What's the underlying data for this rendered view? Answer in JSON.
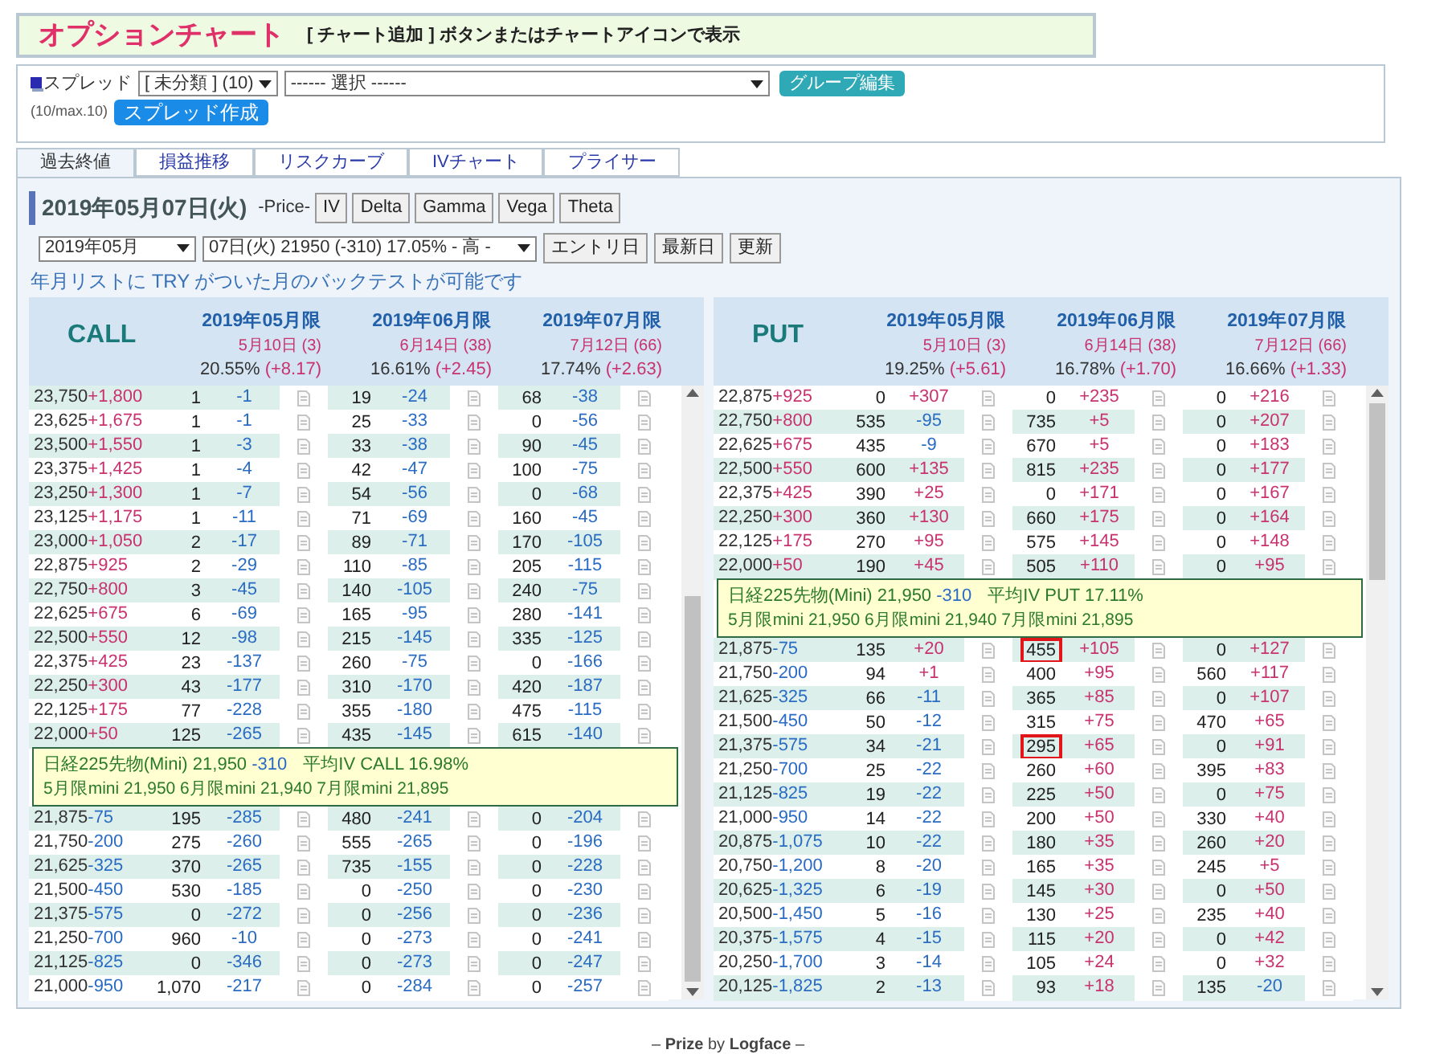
{
  "header": {
    "title": "オプションチャート",
    "hint": "[ チャート追加 ] ボタンまたはチャートアイコンで表示"
  },
  "spread": {
    "label": "スプレッド",
    "group_select": "[ 未分類 ] (10)",
    "spread_select": "------ 選択 ------",
    "edit_button": "グループ編集",
    "count": "(10/max.10)",
    "create_button": "スプレッド作成"
  },
  "tabs": [
    {
      "label": "過去終値",
      "selected": true
    },
    {
      "label": "損益推移",
      "selected": false
    },
    {
      "label": "リスクカーブ",
      "selected": false
    },
    {
      "label": "IVチャート",
      "selected": false
    },
    {
      "label": "プライサー",
      "selected": false
    }
  ],
  "panel": {
    "date": "2019年05月07日(火)",
    "price_label": "-Price-",
    "metric_buttons": [
      "IV",
      "Delta",
      "Gamma",
      "Vega",
      "Theta"
    ],
    "month_select": "2019年05月",
    "day_select": "07日(火) 21950 (-310) 17.05% - 高 -",
    "action_buttons": [
      "エントリ日",
      "最新日",
      "更新"
    ],
    "note": "年月リストに TRY がついた月のバックテストが可能です"
  },
  "tables": [
    {
      "title": "CALL",
      "months": [
        {
          "name": "2019年05月限",
          "expiry": "5月10日 (3)",
          "iv": "20.55%",
          "iv_change": "(+8.17)"
        },
        {
          "name": "2019年06月限",
          "expiry": "6月14日 (38)",
          "iv": "16.61%",
          "iv_change": "(+2.45)"
        },
        {
          "name": "2019年07月限",
          "expiry": "7月12日 (66)",
          "iv": "17.74%",
          "iv_change": "(+2.63)"
        }
      ],
      "rows_above": [
        {
          "strike": "23,750",
          "diff": "+1,800",
          "diff_up": true,
          "shaded": true,
          "cells": [
            {
              "price": "1",
              "change": "-1",
              "up": false,
              "marked": false
            },
            {
              "price": "19",
              "change": "-24",
              "up": false,
              "marked": false
            },
            {
              "price": "68",
              "change": "-38",
              "up": false,
              "marked": false
            }
          ]
        },
        {
          "strike": "23,625",
          "diff": "+1,675",
          "diff_up": true,
          "shaded": false,
          "cells": [
            {
              "price": "1",
              "change": "-1",
              "up": false,
              "marked": false
            },
            {
              "price": "25",
              "change": "-33",
              "up": false,
              "marked": false
            },
            {
              "price": "0",
              "change": "-56",
              "up": false,
              "marked": false
            }
          ]
        },
        {
          "strike": "23,500",
          "diff": "+1,550",
          "diff_up": true,
          "shaded": true,
          "cells": [
            {
              "price": "1",
              "change": "-3",
              "up": false,
              "marked": false
            },
            {
              "price": "33",
              "change": "-38",
              "up": false,
              "marked": false
            },
            {
              "price": "90",
              "change": "-45",
              "up": false,
              "marked": false
            }
          ]
        },
        {
          "strike": "23,375",
          "diff": "+1,425",
          "diff_up": true,
          "shaded": false,
          "cells": [
            {
              "price": "1",
              "change": "-4",
              "up": false,
              "marked": false
            },
            {
              "price": "42",
              "change": "-47",
              "up": false,
              "marked": false
            },
            {
              "price": "100",
              "change": "-75",
              "up": false,
              "marked": false
            }
          ]
        },
        {
          "strike": "23,250",
          "diff": "+1,300",
          "diff_up": true,
          "shaded": true,
          "cells": [
            {
              "price": "1",
              "change": "-7",
              "up": false,
              "marked": false
            },
            {
              "price": "54",
              "change": "-56",
              "up": false,
              "marked": false
            },
            {
              "price": "0",
              "change": "-68",
              "up": false,
              "marked": false
            }
          ]
        },
        {
          "strike": "23,125",
          "diff": "+1,175",
          "diff_up": true,
          "shaded": false,
          "cells": [
            {
              "price": "1",
              "change": "-11",
              "up": false,
              "marked": false
            },
            {
              "price": "71",
              "change": "-69",
              "up": false,
              "marked": false
            },
            {
              "price": "160",
              "change": "-45",
              "up": false,
              "marked": false
            }
          ]
        },
        {
          "strike": "23,000",
          "diff": "+1,050",
          "diff_up": true,
          "shaded": true,
          "cells": [
            {
              "price": "2",
              "change": "-17",
              "up": false,
              "marked": false
            },
            {
              "price": "89",
              "change": "-71",
              "up": false,
              "marked": false
            },
            {
              "price": "170",
              "change": "-105",
              "up": false,
              "marked": false
            }
          ]
        },
        {
          "strike": "22,875",
          "diff": "+925",
          "diff_up": true,
          "shaded": false,
          "cells": [
            {
              "price": "2",
              "change": "-29",
              "up": false,
              "marked": false
            },
            {
              "price": "110",
              "change": "-85",
              "up": false,
              "marked": false
            },
            {
              "price": "205",
              "change": "-115",
              "up": false,
              "marked": false
            }
          ]
        },
        {
          "strike": "22,750",
          "diff": "+800",
          "diff_up": true,
          "shaded": true,
          "cells": [
            {
              "price": "3",
              "change": "-45",
              "up": false,
              "marked": false
            },
            {
              "price": "140",
              "change": "-105",
              "up": false,
              "marked": false
            },
            {
              "price": "240",
              "change": "-75",
              "up": false,
              "marked": false
            }
          ]
        },
        {
          "strike": "22,625",
          "diff": "+675",
          "diff_up": true,
          "shaded": false,
          "cells": [
            {
              "price": "6",
              "change": "-69",
              "up": false,
              "marked": false
            },
            {
              "price": "165",
              "change": "-95",
              "up": false,
              "marked": false
            },
            {
              "price": "280",
              "change": "-141",
              "up": false,
              "marked": false
            }
          ]
        },
        {
          "strike": "22,500",
          "diff": "+550",
          "diff_up": true,
          "shaded": true,
          "cells": [
            {
              "price": "12",
              "change": "-98",
              "up": false,
              "marked": false
            },
            {
              "price": "215",
              "change": "-145",
              "up": false,
              "marked": false
            },
            {
              "price": "335",
              "change": "-125",
              "up": false,
              "marked": false
            }
          ]
        },
        {
          "strike": "22,375",
          "diff": "+425",
          "diff_up": true,
          "shaded": false,
          "cells": [
            {
              "price": "23",
              "change": "-137",
              "up": false,
              "marked": false
            },
            {
              "price": "260",
              "change": "-75",
              "up": false,
              "marked": false
            },
            {
              "price": "0",
              "change": "-166",
              "up": false,
              "marked": false
            }
          ]
        },
        {
          "strike": "22,250",
          "diff": "+300",
          "diff_up": true,
          "shaded": true,
          "cells": [
            {
              "price": "43",
              "change": "-177",
              "up": false,
              "marked": false
            },
            {
              "price": "310",
              "change": "-170",
              "up": false,
              "marked": false
            },
            {
              "price": "420",
              "change": "-187",
              "up": false,
              "marked": false
            }
          ]
        },
        {
          "strike": "22,125",
          "diff": "+175",
          "diff_up": true,
          "shaded": false,
          "cells": [
            {
              "price": "77",
              "change": "-228",
              "up": false,
              "marked": false
            },
            {
              "price": "355",
              "change": "-180",
              "up": false,
              "marked": false
            },
            {
              "price": "475",
              "change": "-115",
              "up": false,
              "marked": false
            }
          ]
        },
        {
          "strike": "22,000",
          "diff": "+50",
          "diff_up": true,
          "shaded": true,
          "cells": [
            {
              "price": "125",
              "change": "-265",
              "up": false,
              "marked": false
            },
            {
              "price": "435",
              "change": "-145",
              "up": false,
              "marked": false
            },
            {
              "price": "615",
              "change": "-140",
              "up": false,
              "marked": false
            }
          ]
        }
      ],
      "summary": {
        "futures": "日経225先物(Mini) 21,950",
        "futures_change": "-310",
        "average_iv": "平均IV CALL 16.98%",
        "minis": "5月限mini 21,950 6月限mini 21,940 7月限mini 21,895"
      },
      "rows_below": [
        {
          "strike": "21,875",
          "diff": "-75",
          "diff_up": false,
          "shaded": true,
          "cells": [
            {
              "price": "195",
              "change": "-285",
              "up": false,
              "marked": false
            },
            {
              "price": "480",
              "change": "-241",
              "up": false,
              "marked": false
            },
            {
              "price": "0",
              "change": "-204",
              "up": false,
              "marked": false
            }
          ]
        },
        {
          "strike": "21,750",
          "diff": "-200",
          "diff_up": false,
          "shaded": false,
          "cells": [
            {
              "price": "275",
              "change": "-260",
              "up": false,
              "marked": false
            },
            {
              "price": "555",
              "change": "-265",
              "up": false,
              "marked": false
            },
            {
              "price": "0",
              "change": "-196",
              "up": false,
              "marked": false
            }
          ]
        },
        {
          "strike": "21,625",
          "diff": "-325",
          "diff_up": false,
          "shaded": true,
          "cells": [
            {
              "price": "370",
              "change": "-265",
              "up": false,
              "marked": false
            },
            {
              "price": "735",
              "change": "-155",
              "up": false,
              "marked": false
            },
            {
              "price": "0",
              "change": "-228",
              "up": false,
              "marked": false
            }
          ]
        },
        {
          "strike": "21,500",
          "diff": "-450",
          "diff_up": false,
          "shaded": false,
          "cells": [
            {
              "price": "530",
              "change": "-185",
              "up": false,
              "marked": false
            },
            {
              "price": "0",
              "change": "-250",
              "up": false,
              "marked": false
            },
            {
              "price": "0",
              "change": "-230",
              "up": false,
              "marked": false
            }
          ]
        },
        {
          "strike": "21,375",
          "diff": "-575",
          "diff_up": false,
          "shaded": true,
          "cells": [
            {
              "price": "0",
              "change": "-272",
              "up": false,
              "marked": false
            },
            {
              "price": "0",
              "change": "-256",
              "up": false,
              "marked": false
            },
            {
              "price": "0",
              "change": "-236",
              "up": false,
              "marked": false
            }
          ]
        },
        {
          "strike": "21,250",
          "diff": "-700",
          "diff_up": false,
          "shaded": false,
          "cells": [
            {
              "price": "960",
              "change": "-10",
              "up": false,
              "marked": false
            },
            {
              "price": "0",
              "change": "-273",
              "up": false,
              "marked": false
            },
            {
              "price": "0",
              "change": "-241",
              "up": false,
              "marked": false
            }
          ]
        },
        {
          "strike": "21,125",
          "diff": "-825",
          "diff_up": false,
          "shaded": true,
          "cells": [
            {
              "price": "0",
              "change": "-346",
              "up": false,
              "marked": false
            },
            {
              "price": "0",
              "change": "-273",
              "up": false,
              "marked": false
            },
            {
              "price": "0",
              "change": "-247",
              "up": false,
              "marked": false
            }
          ]
        },
        {
          "strike": "21,000",
          "diff": "-950",
          "diff_up": false,
          "shaded": false,
          "cells": [
            {
              "price": "1,070",
              "change": "-217",
              "up": false,
              "marked": false
            },
            {
              "price": "0",
              "change": "-284",
              "up": false,
              "marked": false
            },
            {
              "price": "0",
              "change": "-257",
              "up": false,
              "marked": false
            }
          ]
        }
      ]
    },
    {
      "title": "PUT",
      "months": [
        {
          "name": "2019年05月限",
          "expiry": "5月10日 (3)",
          "iv": "19.25%",
          "iv_change": "(+5.61)"
        },
        {
          "name": "2019年06月限",
          "expiry": "6月14日 (38)",
          "iv": "16.78%",
          "iv_change": "(+1.70)"
        },
        {
          "name": "2019年07月限",
          "expiry": "7月12日 (66)",
          "iv": "16.66%",
          "iv_change": "(+1.33)"
        }
      ],
      "rows_above": [
        {
          "strike": "22,875",
          "diff": "+925",
          "diff_up": true,
          "shaded": false,
          "cells": [
            {
              "price": "0",
              "change": "+307",
              "up": true,
              "marked": false
            },
            {
              "price": "0",
              "change": "+235",
              "up": true,
              "marked": false
            },
            {
              "price": "0",
              "change": "+216",
              "up": true,
              "marked": false
            }
          ]
        },
        {
          "strike": "22,750",
          "diff": "+800",
          "diff_up": true,
          "shaded": true,
          "cells": [
            {
              "price": "535",
              "change": "-95",
              "up": false,
              "marked": false
            },
            {
              "price": "735",
              "change": "+5",
              "up": true,
              "marked": false
            },
            {
              "price": "0",
              "change": "+207",
              "up": true,
              "marked": false
            }
          ]
        },
        {
          "strike": "22,625",
          "diff": "+675",
          "diff_up": true,
          "shaded": false,
          "cells": [
            {
              "price": "435",
              "change": "-9",
              "up": false,
              "marked": false
            },
            {
              "price": "670",
              "change": "+5",
              "up": true,
              "marked": false
            },
            {
              "price": "0",
              "change": "+183",
              "up": true,
              "marked": false
            }
          ]
        },
        {
          "strike": "22,500",
          "diff": "+550",
          "diff_up": true,
          "shaded": true,
          "cells": [
            {
              "price": "600",
              "change": "+135",
              "up": true,
              "marked": false
            },
            {
              "price": "815",
              "change": "+235",
              "up": true,
              "marked": false
            },
            {
              "price": "0",
              "change": "+177",
              "up": true,
              "marked": false
            }
          ]
        },
        {
          "strike": "22,375",
          "diff": "+425",
          "diff_up": true,
          "shaded": false,
          "cells": [
            {
              "price": "390",
              "change": "+25",
              "up": true,
              "marked": false
            },
            {
              "price": "0",
              "change": "+171",
              "up": true,
              "marked": false
            },
            {
              "price": "0",
              "change": "+167",
              "up": true,
              "marked": false
            }
          ]
        },
        {
          "strike": "22,250",
          "diff": "+300",
          "diff_up": true,
          "shaded": true,
          "cells": [
            {
              "price": "360",
              "change": "+130",
              "up": true,
              "marked": false
            },
            {
              "price": "660",
              "change": "+175",
              "up": true,
              "marked": false
            },
            {
              "price": "0",
              "change": "+164",
              "up": true,
              "marked": false
            }
          ]
        },
        {
          "strike": "22,125",
          "diff": "+175",
          "diff_up": true,
          "shaded": false,
          "cells": [
            {
              "price": "270",
              "change": "+95",
              "up": true,
              "marked": false
            },
            {
              "price": "575",
              "change": "+145",
              "up": true,
              "marked": false
            },
            {
              "price": "0",
              "change": "+148",
              "up": true,
              "marked": false
            }
          ]
        },
        {
          "strike": "22,000",
          "diff": "+50",
          "diff_up": true,
          "shaded": true,
          "cells": [
            {
              "price": "190",
              "change": "+45",
              "up": true,
              "marked": false
            },
            {
              "price": "505",
              "change": "+110",
              "up": true,
              "marked": false
            },
            {
              "price": "0",
              "change": "+95",
              "up": true,
              "marked": false
            }
          ]
        }
      ],
      "summary": {
        "futures": "日経225先物(Mini) 21,950",
        "futures_change": "-310",
        "average_iv": "平均IV PUT 17.11%",
        "minis": "5月限mini 21,950 6月限mini 21,940 7月限mini 21,895"
      },
      "rows_below": [
        {
          "strike": "21,875",
          "diff": "-75",
          "diff_up": false,
          "shaded": true,
          "cells": [
            {
              "price": "135",
              "change": "+20",
              "up": true,
              "marked": false
            },
            {
              "price": "455",
              "change": "+105",
              "up": true,
              "marked": true
            },
            {
              "price": "0",
              "change": "+127",
              "up": true,
              "marked": false
            }
          ]
        },
        {
          "strike": "21,750",
          "diff": "-200",
          "diff_up": false,
          "shaded": false,
          "cells": [
            {
              "price": "94",
              "change": "+1",
              "up": true,
              "marked": false
            },
            {
              "price": "400",
              "change": "+95",
              "up": true,
              "marked": false
            },
            {
              "price": "560",
              "change": "+117",
              "up": true,
              "marked": false
            }
          ]
        },
        {
          "strike": "21,625",
          "diff": "-325",
          "diff_up": false,
          "shaded": true,
          "cells": [
            {
              "price": "66",
              "change": "-11",
              "up": false,
              "marked": false
            },
            {
              "price": "365",
              "change": "+85",
              "up": true,
              "marked": false
            },
            {
              "price": "0",
              "change": "+107",
              "up": true,
              "marked": false
            }
          ]
        },
        {
          "strike": "21,500",
          "diff": "-450",
          "diff_up": false,
          "shaded": false,
          "cells": [
            {
              "price": "50",
              "change": "-12",
              "up": false,
              "marked": false
            },
            {
              "price": "315",
              "change": "+75",
              "up": true,
              "marked": false
            },
            {
              "price": "470",
              "change": "+65",
              "up": true,
              "marked": false
            }
          ]
        },
        {
          "strike": "21,375",
          "diff": "-575",
          "diff_up": false,
          "shaded": true,
          "cells": [
            {
              "price": "34",
              "change": "-21",
              "up": false,
              "marked": false
            },
            {
              "price": "295",
              "change": "+65",
              "up": true,
              "marked": true
            },
            {
              "price": "0",
              "change": "+91",
              "up": true,
              "marked": false
            }
          ]
        },
        {
          "strike": "21,250",
          "diff": "-700",
          "diff_up": false,
          "shaded": false,
          "cells": [
            {
              "price": "25",
              "change": "-22",
              "up": false,
              "marked": false
            },
            {
              "price": "260",
              "change": "+60",
              "up": true,
              "marked": false
            },
            {
              "price": "395",
              "change": "+83",
              "up": true,
              "marked": false
            }
          ]
        },
        {
          "strike": "21,125",
          "diff": "-825",
          "diff_up": false,
          "shaded": true,
          "cells": [
            {
              "price": "19",
              "change": "-22",
              "up": false,
              "marked": false
            },
            {
              "price": "225",
              "change": "+50",
              "up": true,
              "marked": false
            },
            {
              "price": "0",
              "change": "+75",
              "up": true,
              "marked": false
            }
          ]
        },
        {
          "strike": "21,000",
          "diff": "-950",
          "diff_up": false,
          "shaded": false,
          "cells": [
            {
              "price": "14",
              "change": "-22",
              "up": false,
              "marked": false
            },
            {
              "price": "200",
              "change": "+50",
              "up": true,
              "marked": false
            },
            {
              "price": "330",
              "change": "+40",
              "up": true,
              "marked": false
            }
          ]
        },
        {
          "strike": "20,875",
          "diff": "-1,075",
          "diff_up": false,
          "shaded": true,
          "cells": [
            {
              "price": "10",
              "change": "-22",
              "up": false,
              "marked": false
            },
            {
              "price": "180",
              "change": "+35",
              "up": true,
              "marked": false
            },
            {
              "price": "260",
              "change": "+20",
              "up": true,
              "marked": false
            }
          ]
        },
        {
          "strike": "20,750",
          "diff": "-1,200",
          "diff_up": false,
          "shaded": false,
          "cells": [
            {
              "price": "8",
              "change": "-20",
              "up": false,
              "marked": false
            },
            {
              "price": "165",
              "change": "+35",
              "up": true,
              "marked": false
            },
            {
              "price": "245",
              "change": "+5",
              "up": true,
              "marked": false
            }
          ]
        },
        {
          "strike": "20,625",
          "diff": "-1,325",
          "diff_up": false,
          "shaded": true,
          "cells": [
            {
              "price": "6",
              "change": "-19",
              "up": false,
              "marked": false
            },
            {
              "price": "145",
              "change": "+30",
              "up": true,
              "marked": false
            },
            {
              "price": "0",
              "change": "+50",
              "up": true,
              "marked": false
            }
          ]
        },
        {
          "strike": "20,500",
          "diff": "-1,450",
          "diff_up": false,
          "shaded": false,
          "cells": [
            {
              "price": "5",
              "change": "-16",
              "up": false,
              "marked": false
            },
            {
              "price": "130",
              "change": "+25",
              "up": true,
              "marked": false
            },
            {
              "price": "235",
              "change": "+40",
              "up": true,
              "marked": false
            }
          ]
        },
        {
          "strike": "20,375",
          "diff": "-1,575",
          "diff_up": false,
          "shaded": true,
          "cells": [
            {
              "price": "4",
              "change": "-15",
              "up": false,
              "marked": false
            },
            {
              "price": "115",
              "change": "+20",
              "up": true,
              "marked": false
            },
            {
              "price": "0",
              "change": "+42",
              "up": true,
              "marked": false
            }
          ]
        },
        {
          "strike": "20,250",
          "diff": "-1,700",
          "diff_up": false,
          "shaded": false,
          "cells": [
            {
              "price": "3",
              "change": "-14",
              "up": false,
              "marked": false
            },
            {
              "price": "105",
              "change": "+24",
              "up": true,
              "marked": false
            },
            {
              "price": "0",
              "change": "+32",
              "up": true,
              "marked": false
            }
          ]
        },
        {
          "strike": "20,125",
          "diff": "-1,825",
          "diff_up": false,
          "shaded": true,
          "cells": [
            {
              "price": "2",
              "change": "-13",
              "up": false,
              "marked": false
            },
            {
              "price": "93",
              "change": "+18",
              "up": true,
              "marked": false
            },
            {
              "price": "135",
              "change": "-20",
              "up": false,
              "marked": false
            }
          ]
        }
      ]
    }
  ],
  "footer": "– **Prize** by **Logface** –"
}
